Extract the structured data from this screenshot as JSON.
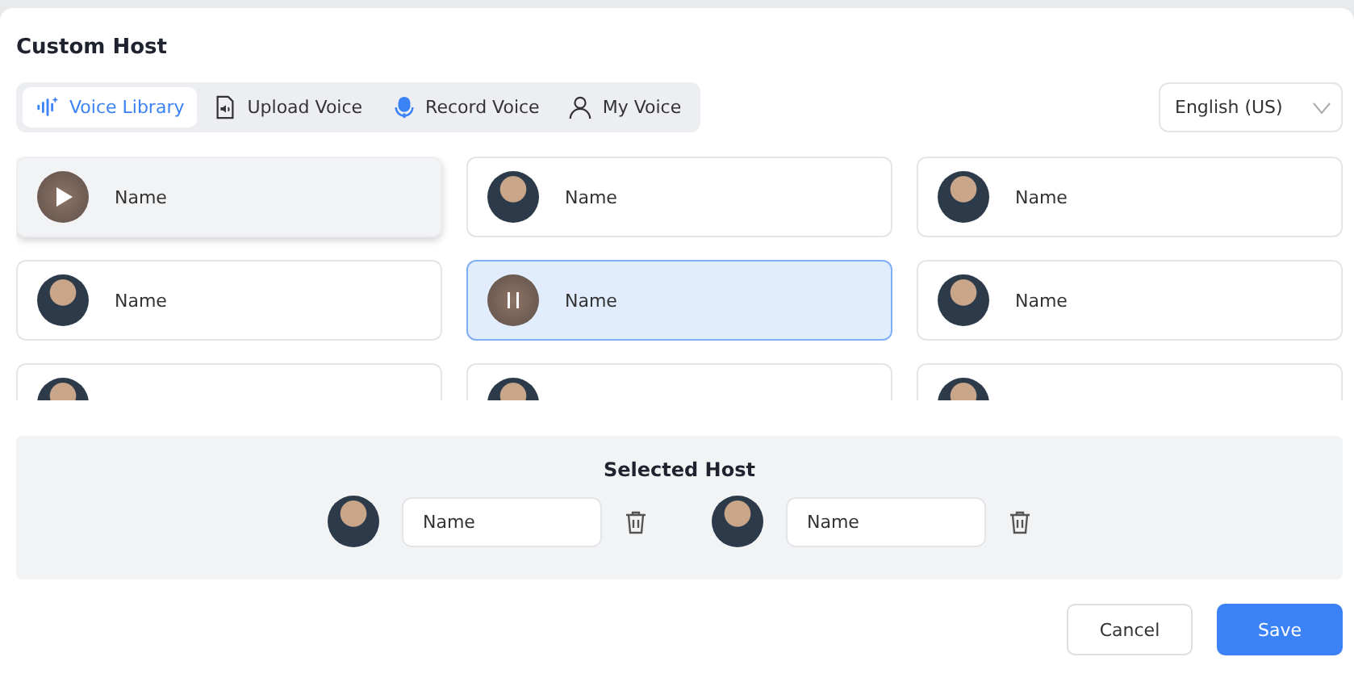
{
  "title": "Custom Host",
  "tabs": [
    {
      "label": "Voice Library",
      "selected": true
    },
    {
      "label": "Upload Voice",
      "selected": false
    },
    {
      "label": "Record Voice",
      "selected": false
    },
    {
      "label": "My Voice",
      "selected": false
    }
  ],
  "language": {
    "value": "English (US)"
  },
  "voices": [
    {
      "name": "Name",
      "hovered": true,
      "selected": false
    },
    {
      "name": "Name",
      "hovered": false,
      "selected": false
    },
    {
      "name": "Name",
      "hovered": false,
      "selected": false
    },
    {
      "name": "Name",
      "hovered": false,
      "selected": false
    },
    {
      "name": "Name",
      "hovered": false,
      "selected": true
    },
    {
      "name": "Name",
      "hovered": false,
      "selected": false
    },
    {
      "hovered": false,
      "selected": false
    },
    {
      "hovered": false,
      "selected": false
    },
    {
      "hovered": false,
      "selected": false
    }
  ],
  "selected_host": {
    "title": "Selected Host",
    "hosts": [
      {
        "value": "Name"
      },
      {
        "value": "Name"
      }
    ]
  },
  "buttons": [
    {
      "label": "Cancel",
      "kind": "secondary"
    },
    {
      "label": "Save",
      "kind": "primary"
    }
  ]
}
